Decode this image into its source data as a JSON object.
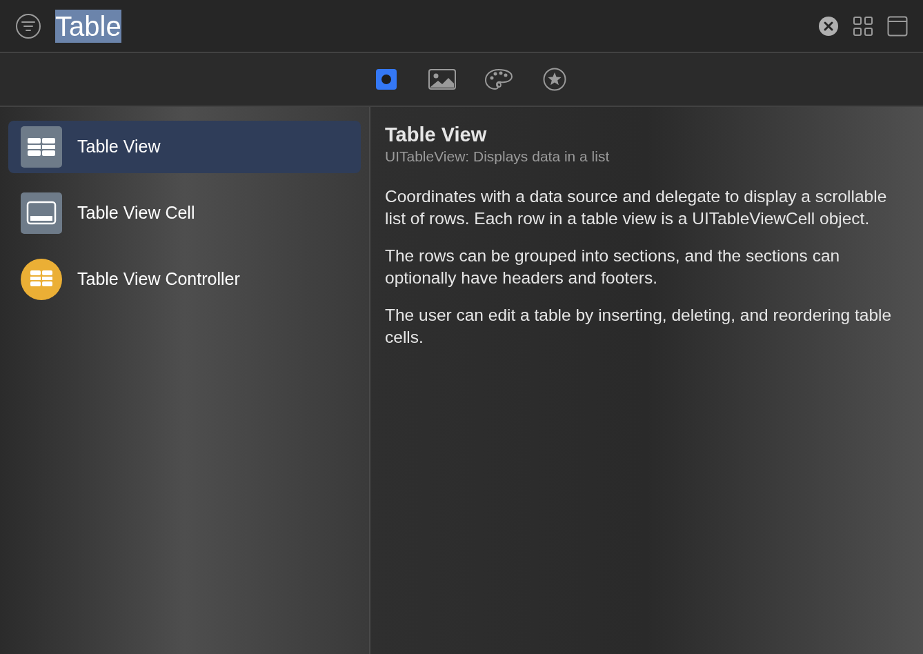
{
  "search": {
    "value": "Table",
    "selected_text": true
  },
  "library_tabs": [
    {
      "kind": "objects",
      "selected": true
    },
    {
      "kind": "images",
      "selected": false
    },
    {
      "kind": "colors",
      "selected": false
    },
    {
      "kind": "symbols",
      "selected": false
    }
  ],
  "items": [
    {
      "kind": "table",
      "label": "Table View",
      "selected": true
    },
    {
      "kind": "cell",
      "label": "Table View Cell",
      "selected": false
    },
    {
      "kind": "controller",
      "label": "Table View Controller",
      "selected": false
    }
  ],
  "detail": {
    "title": "Table View",
    "subtitle": "UITableView: Displays data in a list",
    "paragraphs": [
      "Coordinates with a data source and delegate to display a scrollable list of rows. Each row in a table view is a UITableViewCell object.",
      "The rows can be grouped into sections, and the sections can optionally have headers and footers.",
      "The user can edit a table by inserting, deleting, and reordering table cells."
    ]
  }
}
